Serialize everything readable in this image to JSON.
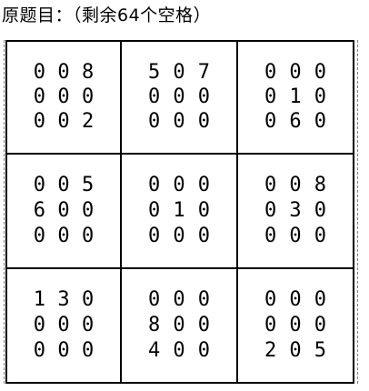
{
  "title": "原题目：（剩余64个空格）",
  "sudoku": {
    "boxes": [
      {
        "cells": [
          "0",
          "0",
          "8",
          "0",
          "0",
          "0",
          "0",
          "0",
          "2"
        ]
      },
      {
        "cells": [
          "5",
          "0",
          "7",
          "0",
          "0",
          "0",
          "0",
          "0",
          "0"
        ]
      },
      {
        "cells": [
          "0",
          "0",
          "0",
          "0",
          "1",
          "0",
          "0",
          "6",
          "0"
        ]
      },
      {
        "cells": [
          "0",
          "0",
          "5",
          "6",
          "0",
          "0",
          "0",
          "0",
          "0"
        ]
      },
      {
        "cells": [
          "0",
          "0",
          "0",
          "0",
          "1",
          "0",
          "0",
          "0",
          "0"
        ]
      },
      {
        "cells": [
          "0",
          "0",
          "8",
          "0",
          "3",
          "0",
          "0",
          "0",
          "0"
        ]
      },
      {
        "cells": [
          "1",
          "3",
          "0",
          "0",
          "0",
          "0",
          "0",
          "0",
          "0"
        ]
      },
      {
        "cells": [
          "0",
          "0",
          "0",
          "8",
          "0",
          "0",
          "4",
          "0",
          "0"
        ]
      },
      {
        "cells": [
          "0",
          "0",
          "0",
          "0",
          "0",
          "0",
          "2",
          "0",
          "5"
        ]
      }
    ]
  }
}
